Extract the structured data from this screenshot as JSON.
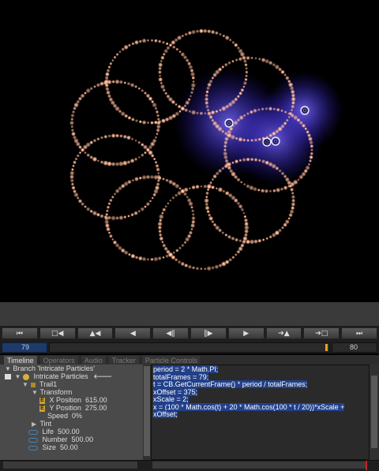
{
  "viewport": {
    "particle_color": "#ffc8a8",
    "glow_color": "#6a5aff",
    "background": "#000000"
  },
  "transport": {
    "buttons": [
      {
        "name": "go-to-start-button",
        "label": "⏮"
      },
      {
        "name": "prev-keyframe-button",
        "label": "□◀"
      },
      {
        "name": "prev-key-button",
        "label": "▲◀"
      },
      {
        "name": "play-reverse-button",
        "label": "◀"
      },
      {
        "name": "step-back-button",
        "label": "◀‖"
      },
      {
        "name": "step-forward-button",
        "label": "‖▶"
      },
      {
        "name": "play-button",
        "label": "▶"
      },
      {
        "name": "next-key-button",
        "label": "➔▲"
      },
      {
        "name": "next-keyframe-button",
        "label": "➔□"
      },
      {
        "name": "go-to-end-button",
        "label": "⏭"
      }
    ],
    "current_frame": "79",
    "end_frame": "80"
  },
  "tabs": [
    "Timeline",
    "Operators",
    "Audio",
    "Tracker",
    "Particle Controls"
  ],
  "active_tab": "Timeline",
  "tree": {
    "branch": "Branch 'Intricate Particles'",
    "layer": "Intricate Particles",
    "trail": "Trail1",
    "transform": "Transform",
    "xpos_label": "X Position",
    "xpos_value": "615.00",
    "ypos_label": "Y Position",
    "ypos_value": "275.00",
    "speed_label": "Speed",
    "speed_value": "0%",
    "tint": "Tint",
    "life_label": "Life",
    "life_value": "500.00",
    "number_label": "Number",
    "number_value": "500.00",
    "size_label": "Size",
    "size_value": "50.00"
  },
  "code": [
    "period = 2 * Math.PI;",
    "totalFrames = 79;",
    "t = CB.GetCurrentFrame() * period / totalFrames;",
    "xOffset = 375;",
    "xScale = 2;",
    "x = (100 * Math.cos(t) + 20 * Math.cos(100 * t / 20))*xScale +",
    "xOffset;"
  ]
}
